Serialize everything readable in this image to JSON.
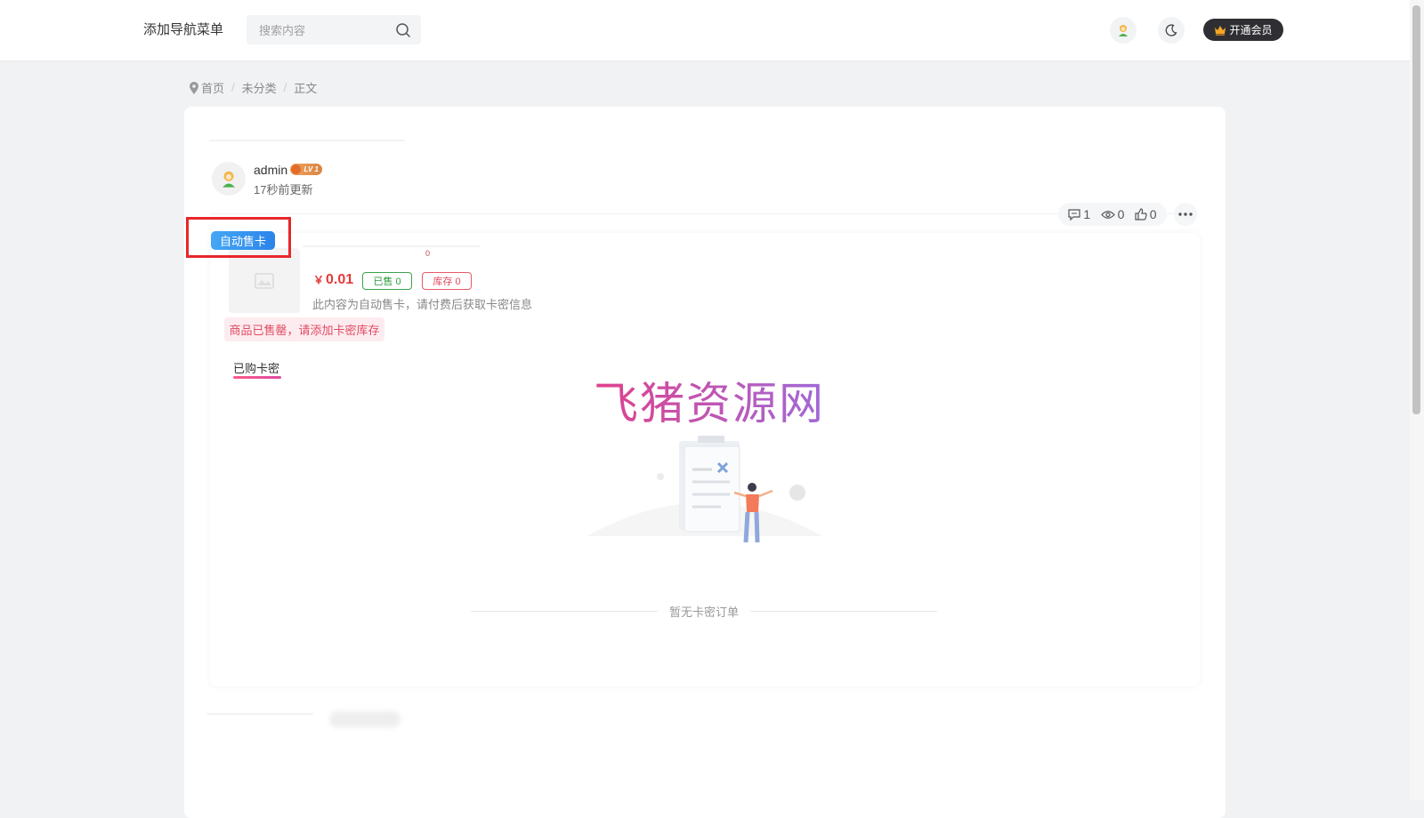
{
  "header": {
    "nav_menu": "添加导航菜单",
    "search_placeholder": "搜索内容",
    "vip_label": "开通会员"
  },
  "breadcrumb": {
    "items": [
      "首页",
      "未分类",
      "正文"
    ]
  },
  "post": {
    "author": "admin",
    "level_badge": "LV 1",
    "updated": "17秒前更新",
    "stats": {
      "comments": "1",
      "views": "0",
      "likes": "0"
    }
  },
  "product": {
    "tag": "自动售卡",
    "tiny_text": "0",
    "currency": "￥",
    "price": "0.01",
    "sold": "已售 0",
    "stock": "库存 0",
    "description": "此内容为自动售卡，请付费后获取卡密信息",
    "soldout_notice": "商品已售罄，请添加卡密库存",
    "tab_purchased": "已购卡密",
    "empty_text": "暂无卡密订单"
  },
  "watermark": "飞猪资源网",
  "colors": {
    "accent_red": "#e33a3a",
    "tag_blue": "#2b84ea",
    "sold_green": "#2e9b3f",
    "highlight_red": "#e8262b",
    "vip_dark": "#2f2f33"
  }
}
